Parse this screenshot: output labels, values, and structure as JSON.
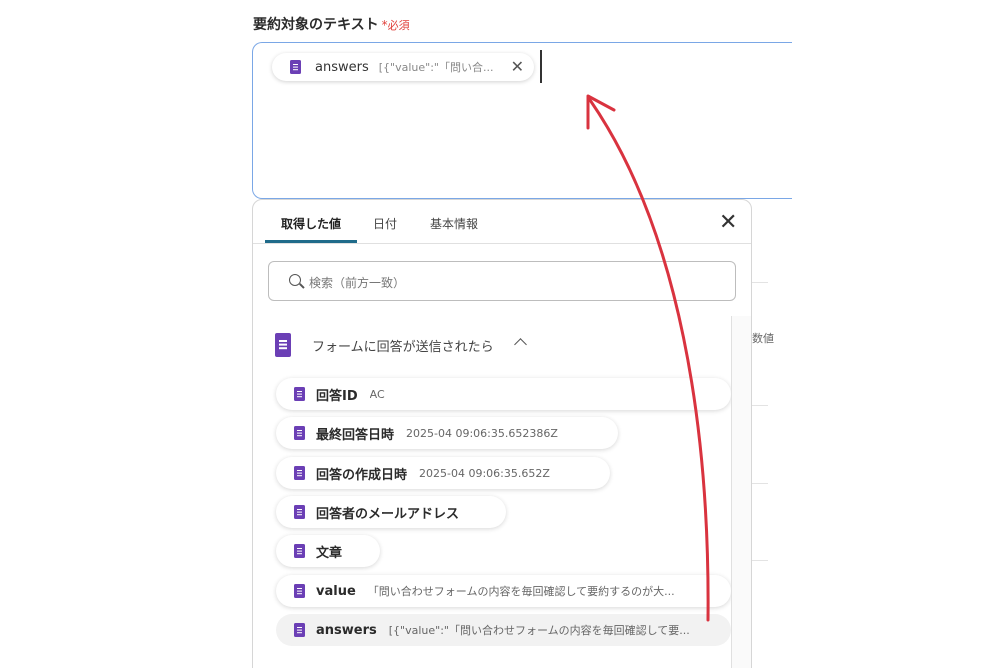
{
  "field": {
    "label": "要約対象のテキスト",
    "required_mark": "*",
    "required_text": "必須"
  },
  "selected_chip": {
    "name": "answers",
    "value": "[{\"value\":\"「問い合...",
    "close_icon": "close-icon"
  },
  "panel": {
    "tabs": [
      {
        "label": "取得した値",
        "active": true
      },
      {
        "label": "日付",
        "active": false
      },
      {
        "label": "基本情報",
        "active": false
      }
    ],
    "close_icon": "close-icon",
    "search": {
      "placeholder": "検索（前方一致）",
      "icon": "search-icon"
    },
    "section": {
      "title": "フォームに回答が送信されたら",
      "icon": "google-forms-icon",
      "expanded": true
    },
    "items": [
      {
        "name": "回答ID",
        "value": "AC"
      },
      {
        "name": "最終回答日時",
        "value": "2025-04 09:06:35.652386Z"
      },
      {
        "name": "回答の作成日時",
        "value": "2025-04 09:06:35.652Z"
      },
      {
        "name": "回答者のメールアドレス",
        "value": ""
      },
      {
        "name": "文章",
        "value": ""
      },
      {
        "name": "value",
        "value": "「問い合わせフォームの内容を毎回確認して要約するのが大..."
      },
      {
        "name": "answers",
        "value": "[{\"value\":\"「問い合わせフォームの内容を毎回確認して要..."
      }
    ]
  },
  "background": {
    "partial_text": "数値"
  },
  "colors": {
    "accent": "#1f6b8a",
    "form_icon": "#6b3fb5",
    "required": "#e0413b",
    "arrow": "#d9333f",
    "focus_border": "#7aa7e6"
  }
}
